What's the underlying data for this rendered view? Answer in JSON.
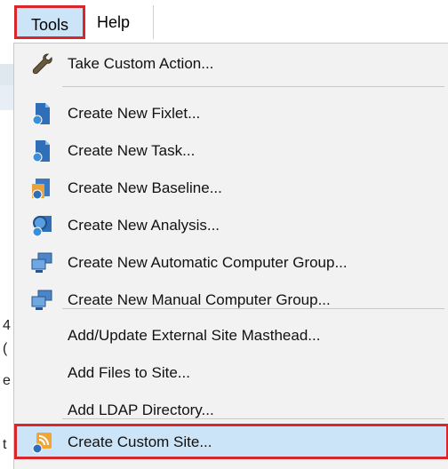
{
  "menubar": {
    "tools_label": "Tools",
    "help_label": "Help"
  },
  "background": {
    "chars": [
      "4",
      "(",
      "e",
      "t"
    ]
  },
  "menu": {
    "items": [
      {
        "label": "Take Custom Action...",
        "icon": "wrench-icon"
      },
      {
        "label": "Create New Fixlet...",
        "icon": "fixlet-icon"
      },
      {
        "label": "Create New Task...",
        "icon": "task-icon"
      },
      {
        "label": "Create New Baseline...",
        "icon": "baseline-icon"
      },
      {
        "label": "Create New Analysis...",
        "icon": "analysis-icon"
      },
      {
        "label": "Create New Automatic Computer Group...",
        "icon": "computer-group-icon"
      },
      {
        "label": "Create New Manual Computer Group...",
        "icon": "computer-group-icon"
      },
      {
        "label": "Add/Update External Site Masthead...",
        "icon": ""
      },
      {
        "label": "Add Files to Site...",
        "icon": ""
      },
      {
        "label": "Add LDAP Directory...",
        "icon": ""
      },
      {
        "label": "Create Custom Site...",
        "icon": "custom-site-icon"
      }
    ]
  },
  "colors": {
    "highlight_border": "#d9262b",
    "highlight_fill": "#cce4f7",
    "menu_bg": "#f2f2f2"
  }
}
